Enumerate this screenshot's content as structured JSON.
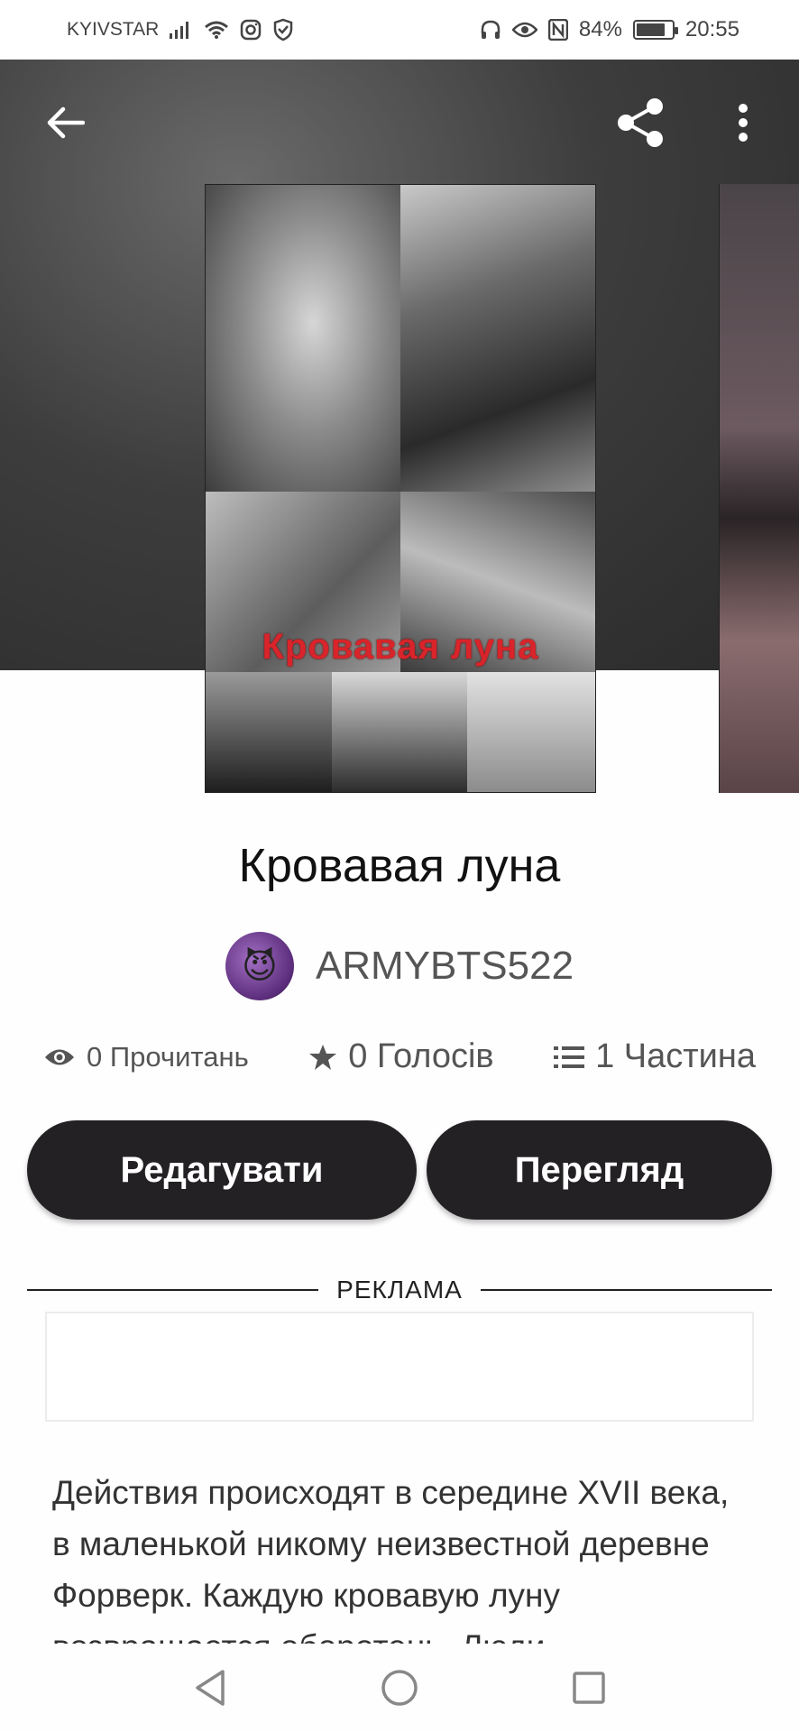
{
  "status_bar": {
    "carrier": "KYIVSTAR",
    "battery_percent": "84%",
    "battery_level": 0.84,
    "time": "20:55",
    "icons": [
      "signal-icon",
      "wifi-icon",
      "instagram-icon",
      "shield-check-icon",
      "headphones-icon",
      "eye-icon",
      "nfc-icon",
      "battery-icon"
    ]
  },
  "header": {
    "back_icon": "arrow-left-icon",
    "share_icon": "share-icon",
    "more_icon": "more-vertical-icon"
  },
  "cover": {
    "title_text": "Кровавая луна"
  },
  "story": {
    "title": "Кровавая луна",
    "author": "ARMYBTS522",
    "avatar_emoji": "😈"
  },
  "stats": {
    "reads": "0 Прочитань",
    "votes": "0 Голосів",
    "parts": "1 Частина"
  },
  "actions": {
    "edit_label": "Редагувати",
    "view_label": "Перегляд"
  },
  "ad": {
    "label": "РЕКЛАМА"
  },
  "description": "Действия происходят в середине XVII века, в маленькой никому неизвестной деревне Форверк. Каждую кровавую луну возвращается оборотень. Люди",
  "colors": {
    "button_bg": "#242124",
    "cover_title": "#d8242a",
    "hero_bg": "#3d3d3d"
  }
}
